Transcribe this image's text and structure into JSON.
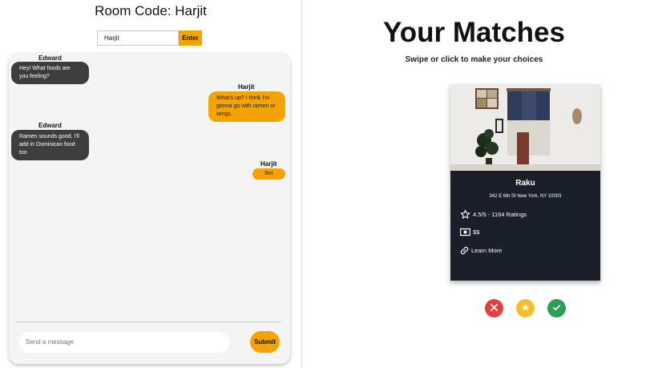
{
  "room": {
    "title": "Room Code: Harjit",
    "input_value": "Harjit",
    "enter_label": "Enter"
  },
  "chat": {
    "messages": [
      {
        "sender": "Edward",
        "text": "Hey! What foods are you feeling?",
        "side": "them"
      },
      {
        "sender": "Harjit",
        "text": "What's up? I think I'm gonna go with ramen or wings.",
        "side": "me"
      },
      {
        "sender": "Edward",
        "text": "Ramen sounds good. I'll add in Dominican food too",
        "side": "them"
      },
      {
        "sender": "Harjit",
        "text": "Bet",
        "side": "me"
      }
    ],
    "input_placeholder": "Send a message",
    "submit_label": "Submit"
  },
  "matches": {
    "title": "Your Matches",
    "subtitle": "Swipe or click to make your choices",
    "card": {
      "name": "Raku",
      "address": "342 E 6th St New York, NY 10003",
      "rating": "4.5/5 -  1164 Ratings",
      "price": "$$",
      "link_label": "Learn More"
    }
  },
  "colors": {
    "accent": "#f5a300",
    "bubble_them": "#3d3d3d",
    "card_bg": "#1b1f2a",
    "reject": "#e04040",
    "favorite": "#f0c030",
    "accept": "#2f9e55"
  },
  "icons": [
    "star-icon",
    "money-icon",
    "link-icon",
    "close-icon",
    "star-icon",
    "check-icon"
  ]
}
